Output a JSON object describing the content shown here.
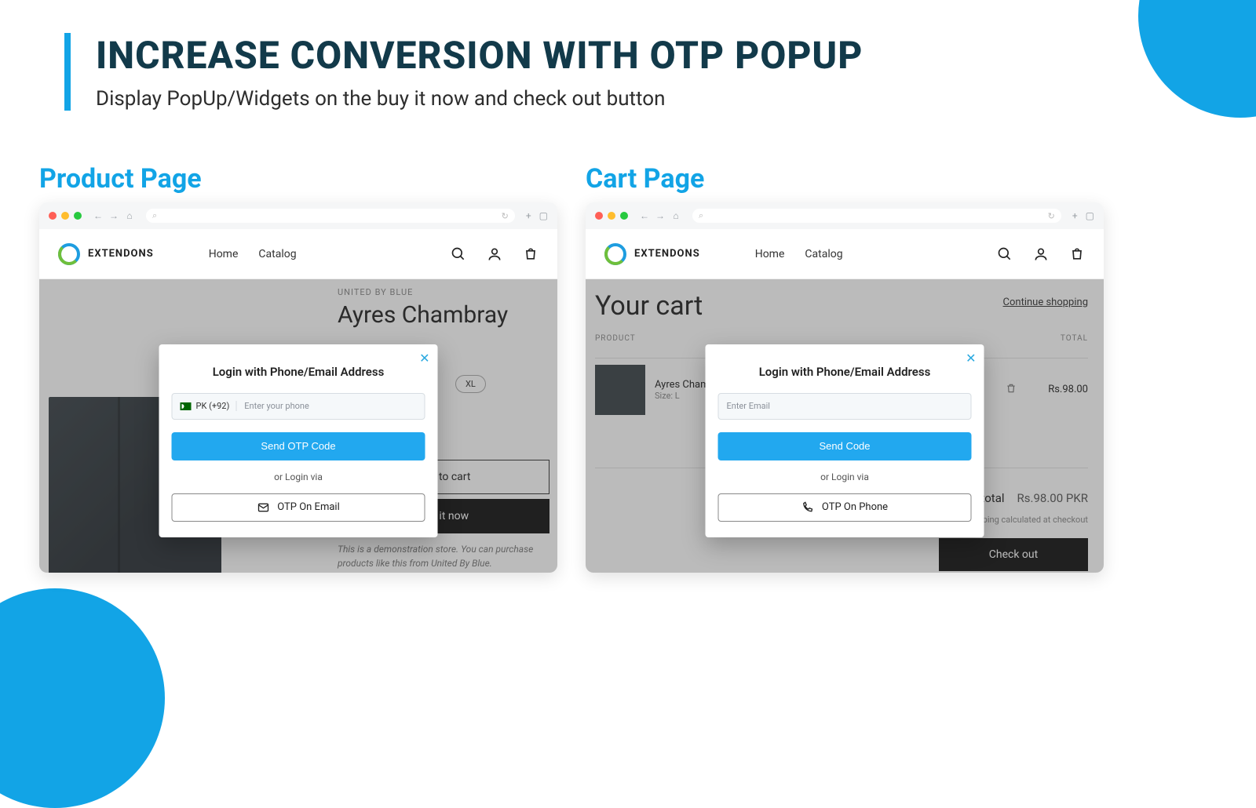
{
  "header": {
    "title": "INCREASE CONVERSION WITH OTP POPUP",
    "subtitle": "Display PopUp/Widgets on the buy it now and check out button"
  },
  "accent_color": "#12a4e6",
  "labels": {
    "product": "Product Page",
    "cart": "Cart Page"
  },
  "store": {
    "brand": "EXTENDONS",
    "nav": {
      "home": "Home",
      "catalog": "Catalog"
    }
  },
  "product_page": {
    "vendor": "UNITED BY BLUE",
    "title": "Ayres Chambray",
    "size_xl": "XL",
    "add_to_cart": "Add to cart",
    "buy_now": "Buy it now",
    "note": "This is a demonstration store. You can purchase products like this from United By Blue."
  },
  "cart_page": {
    "title": "Your cart",
    "continue": "Continue shopping",
    "th_product": "PRODUCT",
    "th_total": "TOTAL",
    "item_name": "Ayres Chambray",
    "item_size": "Size: L",
    "item_price": "Rs.98.00",
    "subtotal_label": "Subtotal",
    "subtotal_value": "Rs.98.00 PKR",
    "tax_note": "Taxes and shipping calculated at checkout",
    "checkout": "Check out"
  },
  "popup": {
    "title": "Login with Phone/Email Address",
    "country_code": "PK (+92)",
    "phone_placeholder": "Enter your phone",
    "email_placeholder": "Enter Email",
    "send_otp": "Send OTP Code",
    "send_code": "Send Code",
    "or_via": "or Login via",
    "otp_email": "OTP On Email",
    "otp_phone": "OTP On Phone"
  }
}
